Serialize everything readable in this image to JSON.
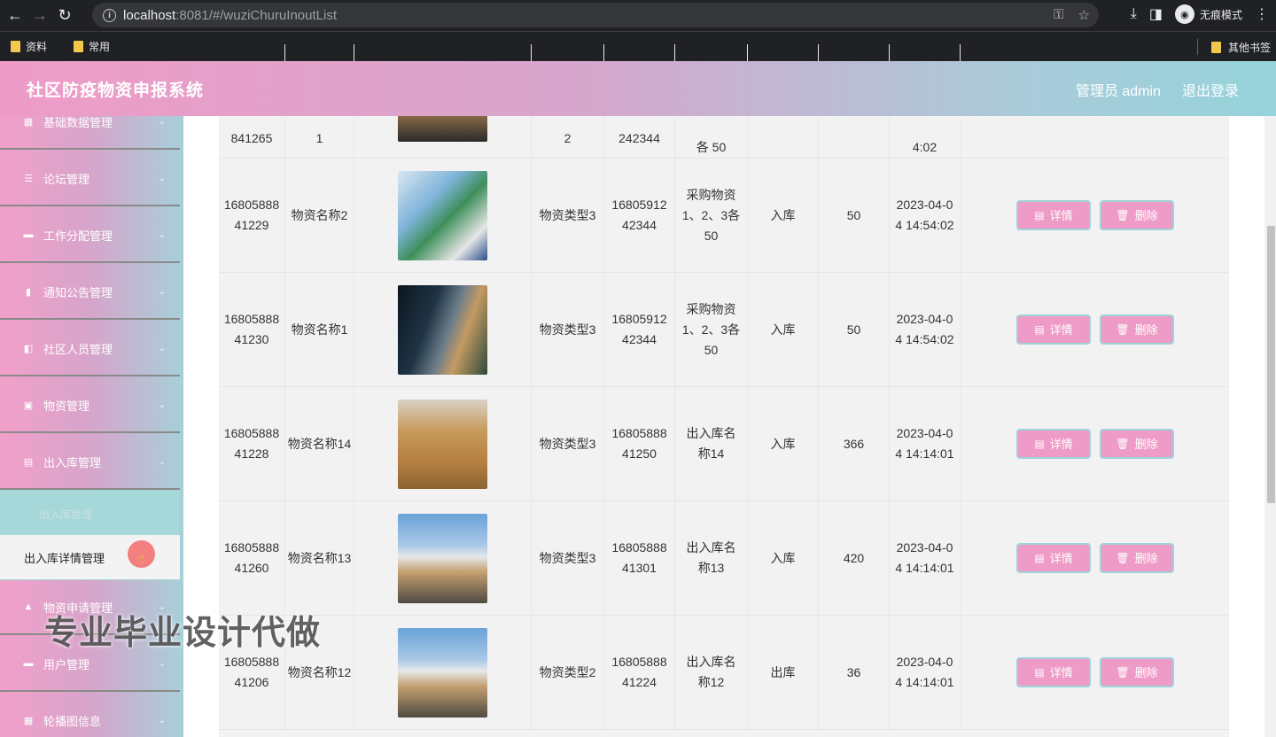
{
  "browser": {
    "url_host": "localhost",
    "url_rest": ":8081/#/wuziChuruInoutList",
    "incognito_label": "无痕模式",
    "bookmarks": [
      "资料",
      "常用"
    ],
    "other_bookmarks": "其他书签"
  },
  "header": {
    "title": "社区防疫物资申报系统",
    "user_label": "管理员 admin",
    "logout_label": "退出登录"
  },
  "sidebar": {
    "items": [
      {
        "label": "基础数据管理",
        "icon": "grid-icon"
      },
      {
        "label": "论坛管理",
        "icon": "sliders-icon"
      },
      {
        "label": "工作分配管理",
        "icon": "monitor-icon"
      },
      {
        "label": "通知公告管理",
        "icon": "bar-chart-icon"
      },
      {
        "label": "社区人员管理",
        "icon": "video-icon"
      },
      {
        "label": "物资管理",
        "icon": "image-icon"
      },
      {
        "label": "出入库管理",
        "icon": "clipboard-icon"
      },
      {
        "label": "物资申请管理",
        "icon": "thumbs-up-icon"
      },
      {
        "label": "用户管理",
        "icon": "monitor-icon"
      },
      {
        "label": "轮播图信息",
        "icon": "grid-icon"
      }
    ],
    "submenu_faded": "出入库管理",
    "submenu_active": "出入库详情管理"
  },
  "watermark": "专业毕业设计代做",
  "table": {
    "partial_row": {
      "id_tail": "841265",
      "name_tail": "1",
      "type_tail": "2",
      "num_tail": "242344",
      "desc_tail": "各 50",
      "time_tail": "4:02"
    },
    "rows": [
      {
        "id": "1680588841229",
        "name": "物资名称2",
        "img": "store",
        "type": "物资类型3",
        "num": "1680591242344",
        "desc": "采购物资1、2、3各 50",
        "io": "入库",
        "qty": "50",
        "time": "2023-04-04 14:54:02"
      },
      {
        "id": "1680588841230",
        "name": "物资名称1",
        "img": "truck",
        "type": "物资类型3",
        "num": "1680591242344",
        "desc": "采购物资1、2、3各 50",
        "io": "入库",
        "qty": "50",
        "time": "2023-04-04 14:54:02"
      },
      {
        "id": "1680588841228",
        "name": "物资名称14",
        "img": "cartons",
        "type": "物资类型3",
        "num": "1680588841250",
        "desc": "出入库名称14",
        "io": "入库",
        "qty": "366",
        "time": "2023-04-04 14:14:01"
      },
      {
        "id": "1680588841260",
        "name": "物资名称13",
        "img": "plane",
        "type": "物资类型3",
        "num": "1680588841301",
        "desc": "出入库名称13",
        "io": "入库",
        "qty": "420",
        "time": "2023-04-04 14:14:01"
      },
      {
        "id": "1680588841206",
        "name": "物资名称12",
        "img": "plane",
        "type": "物资类型2",
        "num": "1680588841224",
        "desc": "出入库名称12",
        "io": "出库",
        "qty": "36",
        "time": "2023-04-04 14:14:01"
      }
    ],
    "detail_label": "详情",
    "delete_label": "删除"
  }
}
